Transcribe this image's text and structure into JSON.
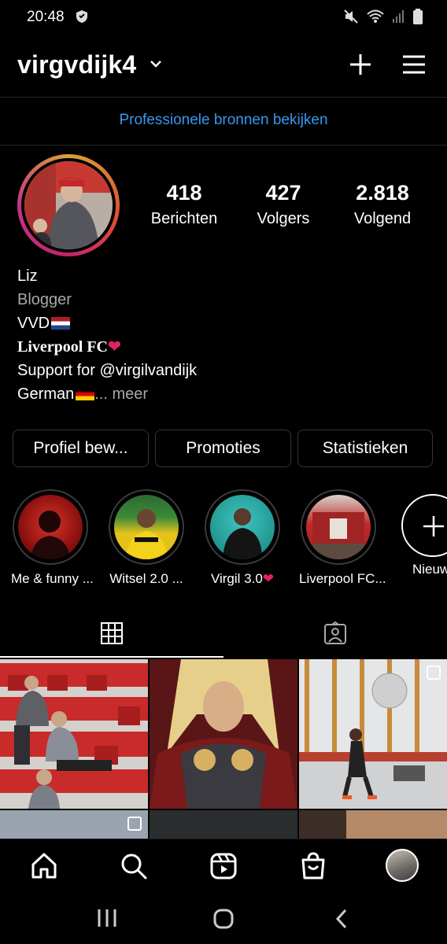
{
  "status": {
    "time": "20:48"
  },
  "header": {
    "username": "virgvdijk4"
  },
  "pro_link": "Professionele bronnen bekijken",
  "stats": [
    {
      "value": "418",
      "label": "Berichten"
    },
    {
      "value": "427",
      "label": "Volgers"
    },
    {
      "value": "2.818",
      "label": "Volgend"
    }
  ],
  "bio": {
    "name": "Liz",
    "category": "Blogger",
    "line1": "VVD",
    "line2": "Liverpool FC",
    "line3": "Support for @virgilvandijk",
    "line4": "German",
    "more": "... meer"
  },
  "buttons": {
    "edit_profile": "Profiel bew...",
    "promotions": "Promoties",
    "insights": "Statistieken"
  },
  "highlights": [
    {
      "label": "Me & funny ..."
    },
    {
      "label": "Witsel 2.0 ..."
    },
    {
      "label": "Virgil 3.0"
    },
    {
      "label": "Liverpool FC..."
    },
    {
      "label": "Nieuw"
    }
  ],
  "colors": {
    "accent": "#3897f0",
    "bg": "#000000",
    "heart": "#e0245e"
  }
}
